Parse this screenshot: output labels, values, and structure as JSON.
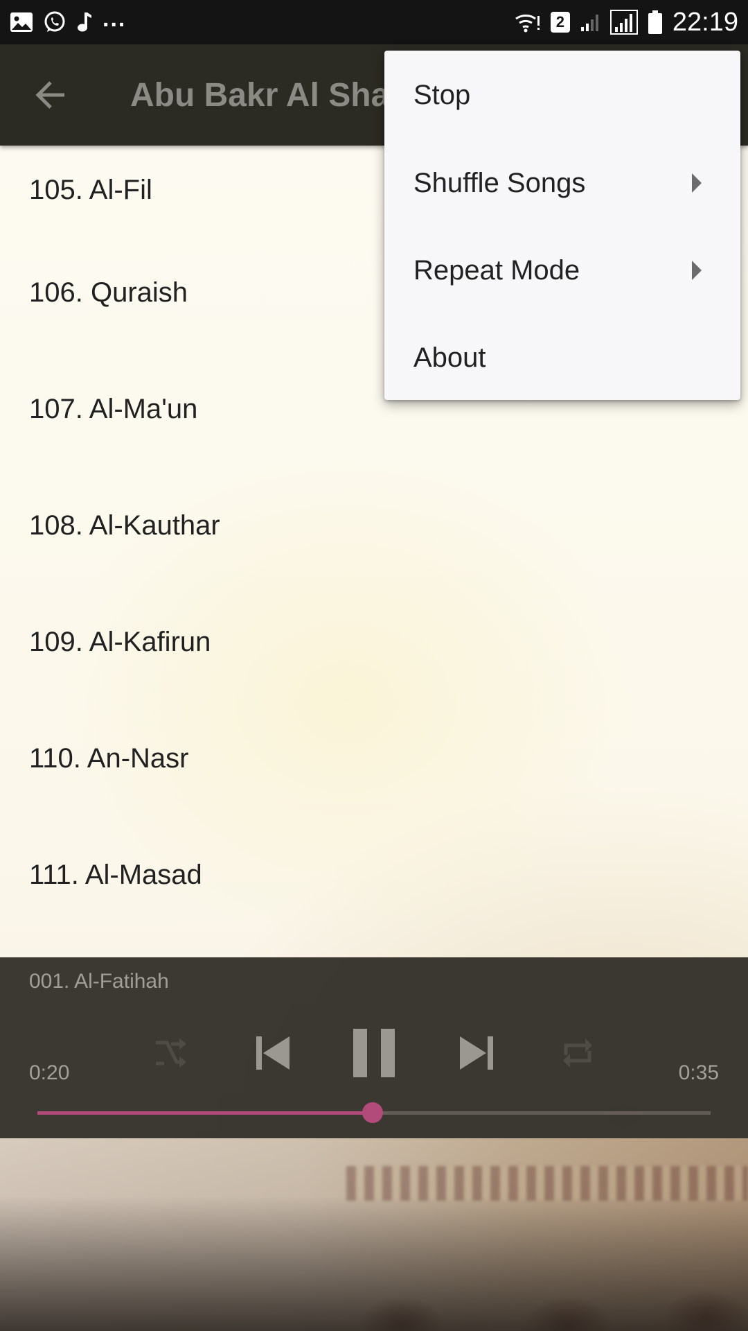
{
  "status_bar": {
    "left_icons": [
      "gallery-icon",
      "whatsapp-icon",
      "music-note-icon"
    ],
    "more_notifications": "...",
    "sim_badge": "2",
    "time": "22:19"
  },
  "app_bar": {
    "title": "Abu Bakr Al Sha"
  },
  "tracks": [
    "105. Al-Fil",
    "106. Quraish",
    "107. Al-Ma'un",
    "108. Al-Kauthar",
    "109. Al-Kafirun",
    "110. An-Nasr",
    "111. Al-Masad"
  ],
  "player": {
    "now_playing": "001. Al-Fatihah",
    "time_current": "0:20",
    "time_total": "0:35",
    "progress_fraction": 0.4983,
    "accent_color": "#b24a7a"
  },
  "menu": {
    "items": [
      {
        "label": "Stop",
        "has_submenu": false
      },
      {
        "label": "Shuffle Songs",
        "has_submenu": true
      },
      {
        "label": "Repeat Mode",
        "has_submenu": true
      },
      {
        "label": "About",
        "has_submenu": false
      }
    ]
  }
}
